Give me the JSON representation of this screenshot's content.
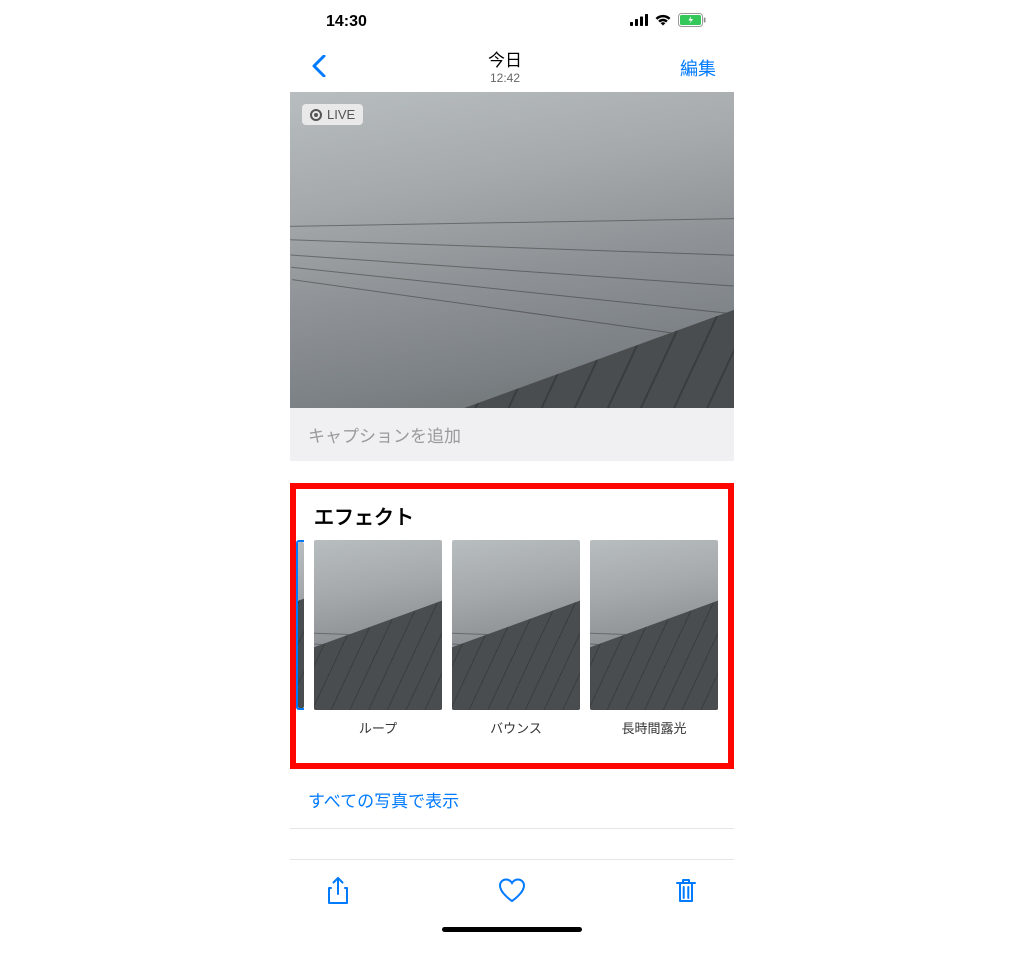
{
  "status": {
    "time": "14:30"
  },
  "nav": {
    "title": "今日",
    "subtitle": "12:42",
    "edit": "編集"
  },
  "live_badge": "LIVE",
  "caption_placeholder": "キャプションを追加",
  "effects": {
    "title": "エフェクト",
    "items": [
      {
        "label": "ループ"
      },
      {
        "label": "バウンス"
      },
      {
        "label": "長時間露光"
      }
    ]
  },
  "show_all": "すべての写真で表示"
}
